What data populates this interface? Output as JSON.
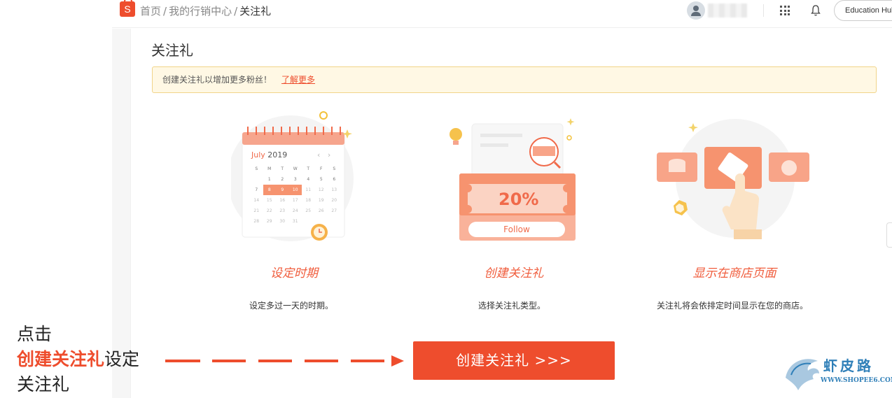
{
  "header": {
    "logo_letter": "S",
    "breadcrumb": [
      {
        "label": "首页"
      },
      {
        "label": "我的行销中心"
      },
      {
        "label": "关注礼"
      }
    ],
    "breadcrumb_sep": "/",
    "store_button": "Education Hul"
  },
  "page": {
    "title": "关注礼",
    "banner_text": "创建关注礼以增加更多粉丝！",
    "banner_link": "了解更多"
  },
  "steps": [
    {
      "title": "设定时期",
      "desc": "设定多过一天的时期。"
    },
    {
      "title": "创建关注礼",
      "desc": "选择关注礼类型。"
    },
    {
      "title": "显示在商店页面",
      "desc": "关注礼将会依排定时间显示在您的商店。"
    }
  ],
  "calendar": {
    "month": "July",
    "year": "2019",
    "weekdays": [
      "S",
      "M",
      "T",
      "W",
      "T",
      "F",
      "S"
    ],
    "rows": [
      [
        "",
        "1",
        "2",
        "3",
        "4",
        "5",
        "6"
      ],
      [
        "7",
        "8",
        "9",
        "10",
        "11",
        "12",
        "13"
      ],
      [
        "14",
        "15",
        "16",
        "17",
        "18",
        "19",
        "20"
      ],
      [
        "21",
        "22",
        "23",
        "24",
        "25",
        "26",
        "27"
      ],
      [
        "28",
        "29",
        "30",
        "31",
        "",
        "",
        ""
      ]
    ],
    "selected": [
      "8",
      "9",
      "10"
    ]
  },
  "voucher": {
    "percent": "20%",
    "follow_label": "Follow"
  },
  "cta": {
    "label": "创建关注礼 >>>"
  },
  "annotation": {
    "line1": "点击",
    "highlight": "创建关注礼",
    "line2_rest": "设定",
    "line3": "关注礼"
  },
  "watermark": {
    "text": "虾皮路",
    "url": "WWW.SHOPEE6.COM"
  },
  "colors": {
    "brand": "#ee4d2d",
    "banner_bg": "#fff8e4",
    "banner_border": "#f1d489",
    "step_title": "#f05d3d"
  }
}
